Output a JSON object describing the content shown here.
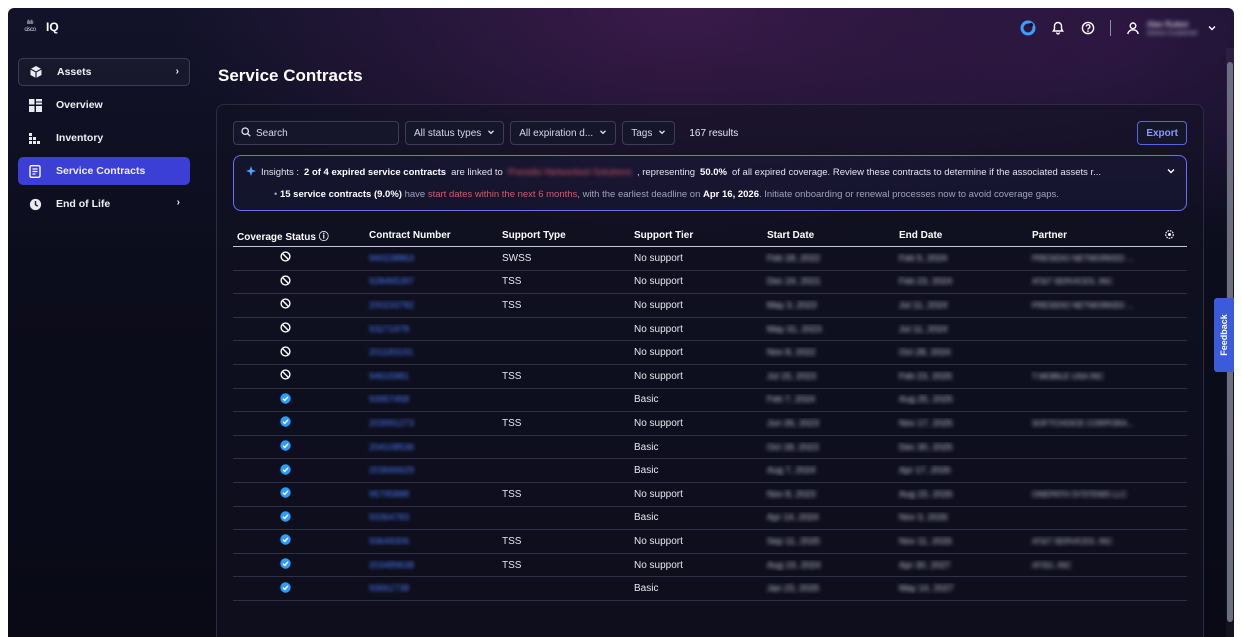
{
  "app": {
    "brand": "cisco",
    "name": "IQ"
  },
  "topbar": {
    "user_name": "Alan Rubior",
    "user_org": "Demo Customer"
  },
  "sidebar": {
    "items": [
      {
        "label": "Assets",
        "icon": "assets-icon"
      },
      {
        "label": "Overview",
        "icon": "overview-icon"
      },
      {
        "label": "Inventory",
        "icon": "inventory-icon"
      },
      {
        "label": "Service Contracts",
        "icon": "contract-icon"
      },
      {
        "label": "End of Life",
        "icon": "clock-icon"
      }
    ]
  },
  "page": {
    "title": "Service Contracts"
  },
  "toolbar": {
    "search_placeholder": "Search",
    "filter_status": "All status types",
    "filter_expiration": "All expiration d...",
    "filter_tags": "Tags",
    "results": "167 results",
    "export": "Export"
  },
  "insights": {
    "prefix": "Insights :",
    "bold1": "2 of 4 expired service contracts",
    "text1": "are linked to",
    "partner": "Presidio Networked Solutions",
    "text2": ", representing",
    "bold2": "50.0%",
    "text3": "of all expired coverage. Review these contracts to determine if the associated assets r...",
    "bullet_bold": "15 service contracts (9.0%)",
    "bullet_text1": "have",
    "bullet_red": "start dates within the next 6 months",
    "bullet_text2": ", with the earliest deadline on",
    "bullet_date": "Apr 16, 2026",
    "bullet_text3": ". Initiate onboarding or renewal processes now to avoid coverage gaps."
  },
  "table": {
    "columns": [
      "Coverage Status",
      "Contract Number",
      "Support Type",
      "Support Tier",
      "Start Date",
      "End Date",
      "Partner"
    ],
    "rows": [
      {
        "status": "none",
        "contract": "940238863",
        "type": "SWSS",
        "tier": "No support",
        "start": "Feb 18, 2022",
        "end": "Feb 5, 2024",
        "partner": "PRESIDIO NETWORKED ..."
      },
      {
        "status": "none",
        "contract": "928465397",
        "type": "TSS",
        "tier": "No support",
        "start": "Dec 24, 2021",
        "end": "Feb 23, 2024",
        "partner": "AT&T SERVICES, INC"
      },
      {
        "status": "none",
        "contract": "200233782",
        "type": "TSS",
        "tier": "No support",
        "start": "May 3, 2023",
        "end": "Jul 11, 2024",
        "partner": "PRESIDIO NETWORKED ..."
      },
      {
        "status": "none",
        "contract": "93271978",
        "type": "",
        "tier": "No support",
        "start": "May 31, 2023",
        "end": "Jul 11, 2024",
        "partner": ""
      },
      {
        "status": "none",
        "contract": "201183191",
        "type": "",
        "tier": "No support",
        "start": "Nov 8, 2022",
        "end": "Oct 28, 2024",
        "partner": ""
      },
      {
        "status": "none",
        "contract": "94615981",
        "type": "TSS",
        "tier": "No support",
        "start": "Jul 15, 2023",
        "end": "Feb 23, 2025",
        "partner": "T-MOBILE USA INC"
      },
      {
        "status": "covered",
        "contract": "93957458",
        "type": "",
        "tier": "Basic",
        "start": "Feb 7, 2024",
        "end": "Aug 25, 2025",
        "partner": ""
      },
      {
        "status": "covered",
        "contract": "203991273",
        "type": "TSS",
        "tier": "No support",
        "start": "Jun 26, 2023",
        "end": "Nov 17, 2025",
        "partner": "SOFTCHOICE CORPORA..."
      },
      {
        "status": "covered",
        "contract": "204108536",
        "type": "",
        "tier": "Basic",
        "start": "Oct 18, 2023",
        "end": "Dec 30, 2025",
        "partner": ""
      },
      {
        "status": "covered",
        "contract": "203666629",
        "type": "",
        "tier": "Basic",
        "start": "Aug 7, 2024",
        "end": "Apr 17, 2026",
        "partner": ""
      },
      {
        "status": "covered",
        "contract": "95795888",
        "type": "TSS",
        "tier": "No support",
        "start": "Nov 8, 2023",
        "end": "Aug 15, 2026",
        "partner": "ONEPATH SYSTEMS LLC"
      },
      {
        "status": "covered",
        "contract": "93364783",
        "type": "",
        "tier": "Basic",
        "start": "Apr 14, 2024",
        "end": "Nov 3, 2026",
        "partner": ""
      },
      {
        "status": "covered",
        "contract": "93649306",
        "type": "TSS",
        "tier": "No support",
        "start": "Sep 11, 2025",
        "end": "Nov 11, 2026",
        "partner": "AT&T SERVICES, INC"
      },
      {
        "status": "covered",
        "contract": "203489638",
        "type": "TSS",
        "tier": "No support",
        "start": "Aug 19, 2024",
        "end": "Apr 30, 2027",
        "partner": "ATSG, INC"
      },
      {
        "status": "covered",
        "contract": "93661738",
        "type": "",
        "tier": "Basic",
        "start": "Jan 23, 2025",
        "end": "May 14, 2027",
        "partner": ""
      }
    ]
  },
  "feedback": {
    "label": "Feedback"
  },
  "colors": {
    "accent": "#3b3fd6",
    "link": "#4a7dff",
    "covered": "#2d9cff",
    "warning": "#d65a66"
  }
}
